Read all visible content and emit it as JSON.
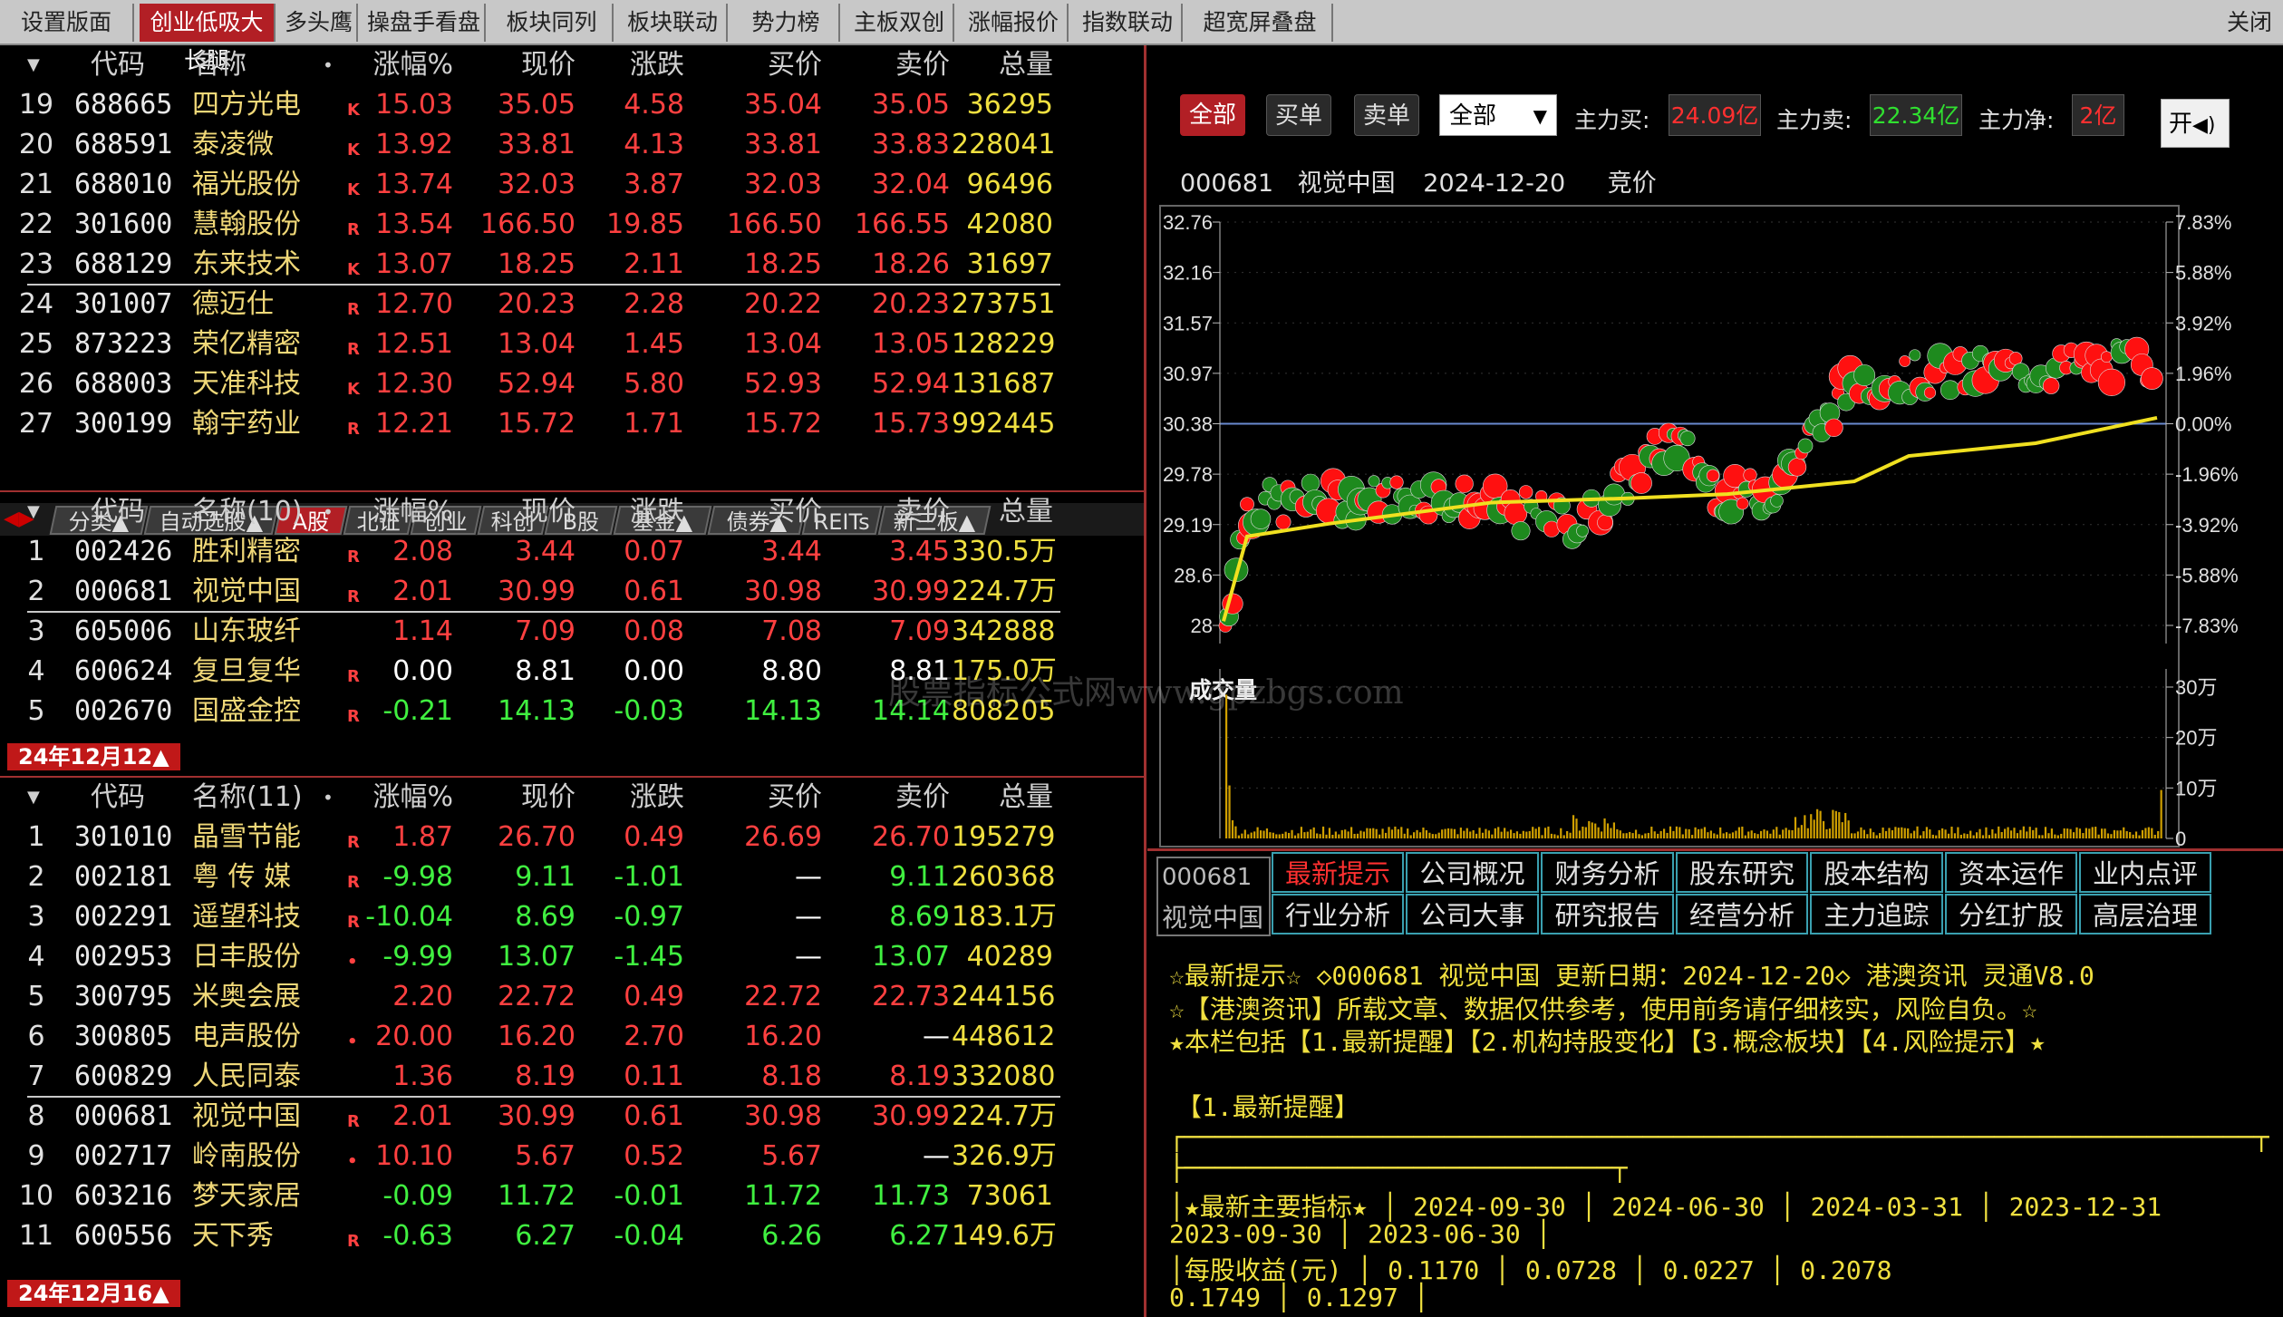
{
  "tabs": [
    "设置版面",
    "创业低吸大长腿",
    "多头鹰",
    "操盘手看盘",
    "板块同列",
    "板块联动",
    "势力榜",
    "主板双创",
    "涨幅报价",
    "指数联动",
    "超宽屏叠盘"
  ],
  "active_tab": 1,
  "close_label": "关闭",
  "columns": [
    "代码",
    "名称",
    "涨幅%",
    "现价",
    "涨跌",
    "买价",
    "卖价",
    "总量"
  ],
  "panel1": {
    "name_header": "名称",
    "rows": [
      {
        "idx": "19",
        "code": "688665",
        "name": "四方光电",
        "flag": "K",
        "pct": "15.03",
        "price": "35.05",
        "chg": "4.58",
        "bid": "35.04",
        "ask": "35.05",
        "vol": "36295"
      },
      {
        "idx": "20",
        "code": "688591",
        "name": "泰凌微",
        "flag": "K",
        "pct": "13.92",
        "price": "33.81",
        "chg": "4.13",
        "bid": "33.81",
        "ask": "33.83",
        "vol": "228041"
      },
      {
        "idx": "21",
        "code": "688010",
        "name": "福光股份",
        "flag": "K",
        "pct": "13.74",
        "price": "32.03",
        "chg": "3.87",
        "bid": "32.03",
        "ask": "32.04",
        "vol": "96496"
      },
      {
        "idx": "22",
        "code": "301600",
        "name": "慧翰股份",
        "flag": "R",
        "pct": "13.54",
        "price": "166.50",
        "chg": "19.85",
        "bid": "166.50",
        "ask": "166.55",
        "vol": "42080"
      },
      {
        "idx": "23",
        "code": "688129",
        "name": "东来技术",
        "flag": "K",
        "pct": "13.07",
        "price": "18.25",
        "chg": "2.11",
        "bid": "18.25",
        "ask": "18.26",
        "vol": "31697"
      },
      {
        "idx": "24",
        "code": "301007",
        "name": "德迈仕",
        "flag": "R",
        "pct": "12.70",
        "price": "20.23",
        "chg": "2.28",
        "bid": "20.22",
        "ask": "20.23",
        "vol": "273751"
      },
      {
        "idx": "25",
        "code": "873223",
        "name": "荣亿精密",
        "flag": "R",
        "pct": "12.51",
        "price": "13.04",
        "chg": "1.45",
        "bid": "13.04",
        "ask": "13.05",
        "vol": "128229"
      },
      {
        "idx": "26",
        "code": "688003",
        "name": "天准科技",
        "flag": "K",
        "pct": "12.30",
        "price": "52.94",
        "chg": "5.80",
        "bid": "52.93",
        "ask": "52.94",
        "vol": "131687"
      },
      {
        "idx": "27",
        "code": "300199",
        "name": "翰宇药业",
        "flag": "R",
        "pct": "12.21",
        "price": "15.72",
        "chg": "1.71",
        "bid": "15.72",
        "ask": "15.73",
        "vol": "992445"
      }
    ]
  },
  "categories": [
    "分类▲",
    "自动选股▲",
    "A股",
    "北证",
    "创业",
    "科创",
    "B股",
    "基金▲",
    "债券▲",
    "REITs",
    "新三板▲"
  ],
  "active_category": 2,
  "panel2": {
    "name_header": "名称(10)",
    "rows": [
      {
        "idx": "1",
        "code": "002426",
        "name": "胜利精密",
        "flag": "R",
        "pct": "2.08",
        "price": "3.44",
        "chg": "0.07",
        "bid": "3.44",
        "ask": "3.45",
        "vol": "330.5万",
        "c": "red"
      },
      {
        "idx": "2",
        "code": "000681",
        "name": "视觉中国",
        "flag": "R",
        "pct": "2.01",
        "price": "30.99",
        "chg": "0.61",
        "bid": "30.98",
        "ask": "30.99",
        "vol": "224.7万",
        "c": "red"
      },
      {
        "idx": "3",
        "code": "605006",
        "name": "山东玻纤",
        "flag": "",
        "pct": "1.14",
        "price": "7.09",
        "chg": "0.08",
        "bid": "7.08",
        "ask": "7.09",
        "vol": "342888",
        "c": "red"
      },
      {
        "idx": "4",
        "code": "600624",
        "name": "复旦复华",
        "flag": "R",
        "pct": "0.00",
        "price": "8.81",
        "chg": "0.00",
        "bid": "8.80",
        "ask": "8.81",
        "vol": "175.0万",
        "c": "white"
      },
      {
        "idx": "5",
        "code": "002670",
        "name": "国盛金控",
        "flag": "R",
        "pct": "-0.21",
        "price": "14.13",
        "chg": "-0.03",
        "bid": "14.13",
        "ask": "14.14",
        "vol": "808205",
        "c": "green"
      }
    ]
  },
  "date1": "24年12月12▲",
  "panel3": {
    "name_header": "名称(11)",
    "rows": [
      {
        "idx": "1",
        "code": "301010",
        "name": "晶雪节能",
        "flag": "R",
        "pct": "1.87",
        "price": "26.70",
        "chg": "0.49",
        "bid": "26.69",
        "ask": "26.70",
        "vol": "195279",
        "c": "red"
      },
      {
        "idx": "2",
        "code": "002181",
        "name": "粤 传 媒",
        "flag": "R",
        "pct": "-9.98",
        "price": "9.11",
        "chg": "-1.01",
        "bid": "—",
        "ask": "9.11",
        "vol": "260368",
        "c": "green"
      },
      {
        "idx": "3",
        "code": "002291",
        "name": "遥望科技",
        "flag": "R",
        "pct": "-10.04",
        "price": "8.69",
        "chg": "-0.97",
        "bid": "—",
        "ask": "8.69",
        "vol": "183.1万",
        "c": "green"
      },
      {
        "idx": "4",
        "code": "002953",
        "name": "日丰股份",
        "flag": "•",
        "pct": "-9.99",
        "price": "13.07",
        "chg": "-1.45",
        "bid": "—",
        "ask": "13.07",
        "vol": "40289",
        "c": "green"
      },
      {
        "idx": "5",
        "code": "300795",
        "name": "米奥会展",
        "flag": "",
        "pct": "2.20",
        "price": "22.72",
        "chg": "0.49",
        "bid": "22.72",
        "ask": "22.73",
        "vol": "244156",
        "c": "red"
      },
      {
        "idx": "6",
        "code": "300805",
        "name": "电声股份",
        "flag": "•",
        "pct": "20.00",
        "price": "16.20",
        "chg": "2.70",
        "bid": "16.20",
        "ask": "—",
        "vol": "448612",
        "c": "red"
      },
      {
        "idx": "7",
        "code": "600829",
        "name": "人民同泰",
        "flag": "",
        "pct": "1.36",
        "price": "8.19",
        "chg": "0.11",
        "bid": "8.18",
        "ask": "8.19",
        "vol": "332080",
        "c": "red"
      },
      {
        "idx": "8",
        "code": "000681",
        "name": "视觉中国",
        "flag": "R",
        "pct": "2.01",
        "price": "30.99",
        "chg": "0.61",
        "bid": "30.98",
        "ask": "30.99",
        "vol": "224.7万",
        "c": "red"
      },
      {
        "idx": "9",
        "code": "002717",
        "name": "岭南股份",
        "flag": "•",
        "pct": "10.10",
        "price": "5.67",
        "chg": "0.52",
        "bid": "5.67",
        "ask": "—",
        "vol": "326.9万",
        "c": "red"
      },
      {
        "idx": "10",
        "code": "603216",
        "name": "梦天家居",
        "flag": "",
        "pct": "-0.09",
        "price": "11.72",
        "chg": "-0.01",
        "bid": "11.72",
        "ask": "11.73",
        "vol": "73061",
        "c": "green"
      },
      {
        "idx": "11",
        "code": "600556",
        "name": "天下秀",
        "flag": "R",
        "pct": "-0.63",
        "price": "6.27",
        "chg": "-0.04",
        "bid": "6.26",
        "ask": "6.27",
        "vol": "149.6万",
        "c": "green"
      }
    ]
  },
  "date2": "24年12月16▲",
  "flow": {
    "btn_all": "全部",
    "btn_buy": "买单",
    "btn_sell": "卖单",
    "select_value": "全部",
    "buy_label": "主力买:",
    "buy_value": "24.09亿",
    "sell_label": "主力卖:",
    "sell_value": "22.34亿",
    "net_label": "主力净:",
    "net_value": "2亿",
    "open_label": "开"
  },
  "stock": {
    "code": "000681",
    "name": "视觉中国",
    "date": "2024-12-20",
    "mode": "竞价"
  },
  "watermark": "股票指标公式网www.gpzbgs.com",
  "chart_data": {
    "type": "scatter",
    "title": "",
    "left_ticks": [
      "32.76",
      "32.16",
      "31.57",
      "30.97",
      "30.38",
      "29.78",
      "29.19",
      "28.6",
      "28"
    ],
    "right_ticks": [
      "7.83%",
      "5.88%",
      "3.92%",
      "1.96%",
      "0.00%",
      "-1.96%",
      "-3.92%",
      "-5.88%",
      "-7.83%"
    ],
    "ylim": [
      28,
      32.76
    ],
    "volume_label": "成交量",
    "volume_ticks": [
      "30万",
      "20万",
      "10万",
      "0"
    ],
    "note": "intraday auction bubbles (red=buy, green=sell) with yellow average-price line"
  },
  "f10": {
    "code": "000681",
    "name": "视觉中国",
    "tabs_row1": [
      "最新提示",
      "公司概况",
      "财务分析",
      "股东研究",
      "股本结构",
      "资本运作",
      "业内点评"
    ],
    "tabs_row2": [
      "行业分析",
      "公司大事",
      "研究报告",
      "经营分析",
      "主力追踪",
      "分红扩股",
      "高层治理"
    ],
    "lines": [
      "☆最新提示☆ ◇000681 视觉中国 更新日期：2024-12-20◇ 港澳资讯 灵通V8.0",
      "☆【港澳资讯】所载文章、数据仅供参考，使用前务请仔细核实，风险自负。☆",
      "★本栏包括【1.最新提醒】【2.机构持股变化】【3.概念板块】【4.风险提示】★",
      "【1.最新提醒】",
      "┌──────────────────────────────────────────────────────────────────────┬",
      "├────────────────────────────┬",
      "│★最新主要指标★    │ 2024-09-30 │ 2024-06-30 │ 2024-03-31 │ 2023-12-31",
      "    2023-09-30 │  2023-06-30 │",
      "│每股收益(元)       │     0.1170 │     0.0728 │     0.0227 │     0.2078",
      "    0.1749 │    0.1297 │"
    ]
  }
}
